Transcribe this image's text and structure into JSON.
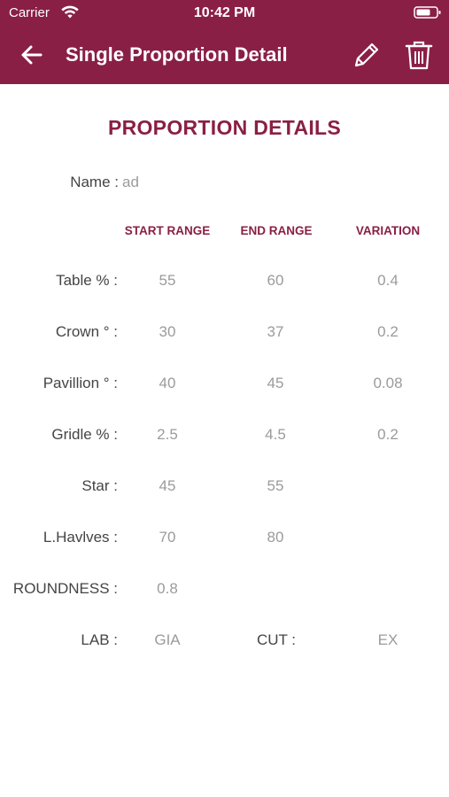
{
  "status_bar": {
    "carrier": "Carrier",
    "time": "10:42 PM"
  },
  "header": {
    "title": "Single Proportion Detail",
    "back_icon": "arrow-left-icon",
    "edit_icon": "pencil-icon",
    "delete_icon": "trash-icon"
  },
  "section_title": "PROPORTION DETAILS",
  "name": {
    "label": "Name :",
    "value": "ad"
  },
  "columns": {
    "start": "START RANGE",
    "end": "END RANGE",
    "variation": "VARIATION"
  },
  "rows": [
    {
      "label": "Table % :",
      "start": "55",
      "end": "60",
      "variation": "0.4"
    },
    {
      "label": "Crown ° :",
      "start": "30",
      "end": "37",
      "variation": "0.2"
    },
    {
      "label": "Pavillion ° :",
      "start": "40",
      "end": "45",
      "variation": "0.08"
    },
    {
      "label": "Gridle % :",
      "start": "2.5",
      "end": "4.5",
      "variation": "0.2"
    },
    {
      "label": "Star :",
      "start": "45",
      "end": "55",
      "variation": ""
    },
    {
      "label": "L.Havlves :",
      "start": "70",
      "end": "80",
      "variation": ""
    },
    {
      "label": "ROUNDNESS :",
      "start": "0.8",
      "end": "",
      "variation": ""
    }
  ],
  "lab": {
    "label": "LAB :",
    "value": "GIA"
  },
  "cut": {
    "label": "CUT :",
    "value": "EX"
  },
  "colors": {
    "primary": "#8A1F45",
    "value_gray": "#9b9b9b",
    "label_dark": "#444444"
  }
}
